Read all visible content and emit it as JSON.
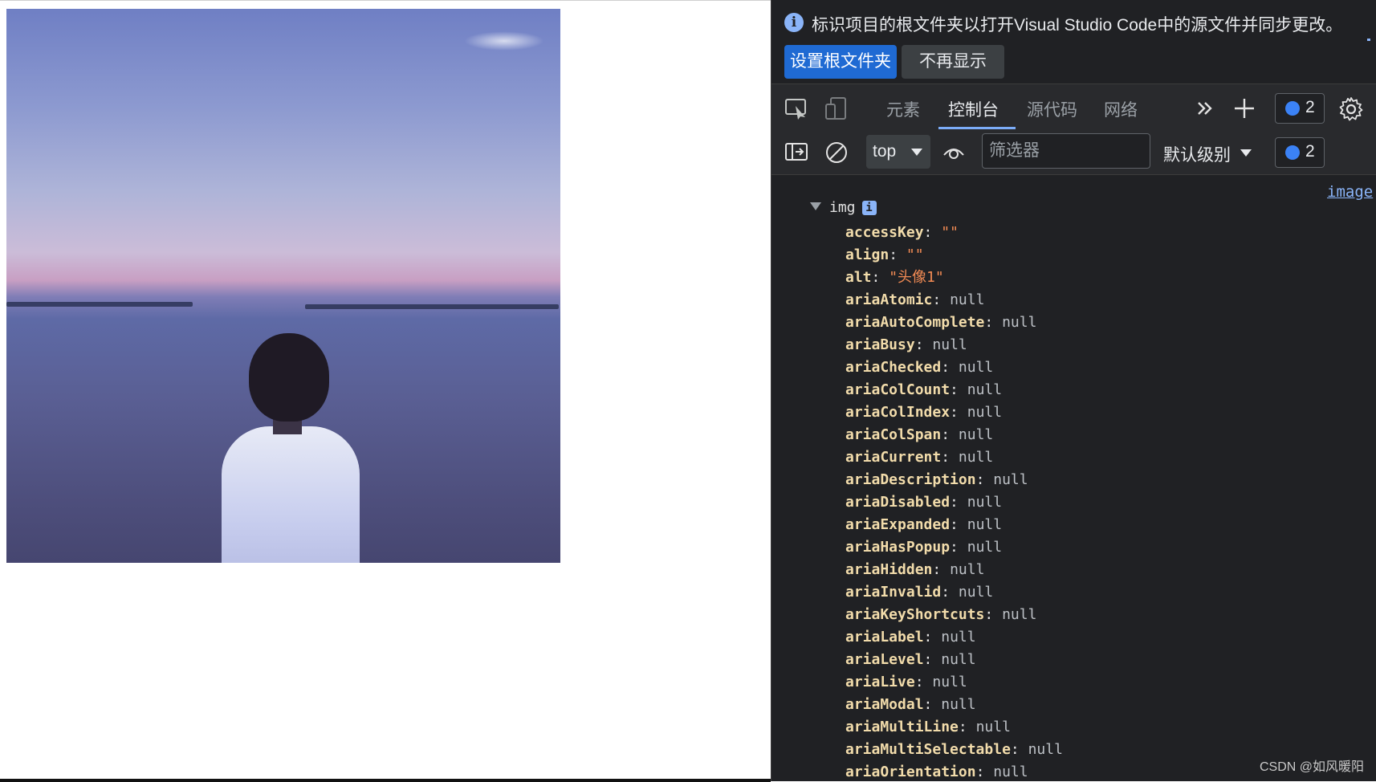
{
  "page": {
    "image_alt": "头像1"
  },
  "infobar": {
    "message": "标识项目的根文件夹以打开Visual Studio Code中的源文件并同步更改。",
    "primary_button": "设置根文件夹",
    "secondary_button": "不再显示"
  },
  "toolbar": {
    "tabs": [
      {
        "label": "元素"
      },
      {
        "label": "控制台"
      },
      {
        "label": "源代码"
      },
      {
        "label": "网络"
      }
    ],
    "active_tab": "控制台",
    "issues_count": "2"
  },
  "filterbar": {
    "context": "top",
    "filter_placeholder": "筛选器",
    "level_label": "默认级别",
    "issues_count": "2"
  },
  "console": {
    "source_link": "image",
    "object_label": "img",
    "info_badge": "i",
    "properties": [
      {
        "key": "accessKey",
        "value": "\"\"",
        "type": "str"
      },
      {
        "key": "align",
        "value": "\"\"",
        "type": "str"
      },
      {
        "key": "alt",
        "value": "\"头像1\"",
        "type": "str"
      },
      {
        "key": "ariaAtomic",
        "value": "null",
        "type": "null"
      },
      {
        "key": "ariaAutoComplete",
        "value": "null",
        "type": "null"
      },
      {
        "key": "ariaBusy",
        "value": "null",
        "type": "null"
      },
      {
        "key": "ariaChecked",
        "value": "null",
        "type": "null"
      },
      {
        "key": "ariaColCount",
        "value": "null",
        "type": "null"
      },
      {
        "key": "ariaColIndex",
        "value": "null",
        "type": "null"
      },
      {
        "key": "ariaColSpan",
        "value": "null",
        "type": "null"
      },
      {
        "key": "ariaCurrent",
        "value": "null",
        "type": "null"
      },
      {
        "key": "ariaDescription",
        "value": "null",
        "type": "null"
      },
      {
        "key": "ariaDisabled",
        "value": "null",
        "type": "null"
      },
      {
        "key": "ariaExpanded",
        "value": "null",
        "type": "null"
      },
      {
        "key": "ariaHasPopup",
        "value": "null",
        "type": "null"
      },
      {
        "key": "ariaHidden",
        "value": "null",
        "type": "null"
      },
      {
        "key": "ariaInvalid",
        "value": "null",
        "type": "null"
      },
      {
        "key": "ariaKeyShortcuts",
        "value": "null",
        "type": "null"
      },
      {
        "key": "ariaLabel",
        "value": "null",
        "type": "null"
      },
      {
        "key": "ariaLevel",
        "value": "null",
        "type": "null"
      },
      {
        "key": "ariaLive",
        "value": "null",
        "type": "null"
      },
      {
        "key": "ariaModal",
        "value": "null",
        "type": "null"
      },
      {
        "key": "ariaMultiLine",
        "value": "null",
        "type": "null"
      },
      {
        "key": "ariaMultiSelectable",
        "value": "null",
        "type": "null"
      },
      {
        "key": "ariaOrientation",
        "value": "null",
        "type": "null"
      }
    ]
  },
  "watermark": "CSDN @如风暖阳",
  "colors": {
    "accent": "#1f6ad3",
    "devtools_bg": "#202124",
    "active_tab_underline": "#7cacf8",
    "property_key": "#f2dcab",
    "string_value": "#f28b54"
  },
  "icons": [
    "inspect-element-icon",
    "device-toolbar-icon",
    "more-tabs-icon",
    "add-tab-icon",
    "issues-icon",
    "settings-icon",
    "sidebar-toggle-icon",
    "clear-console-icon",
    "live-expression-eye-icon",
    "info-icon",
    "expand-triangle-icon"
  ]
}
